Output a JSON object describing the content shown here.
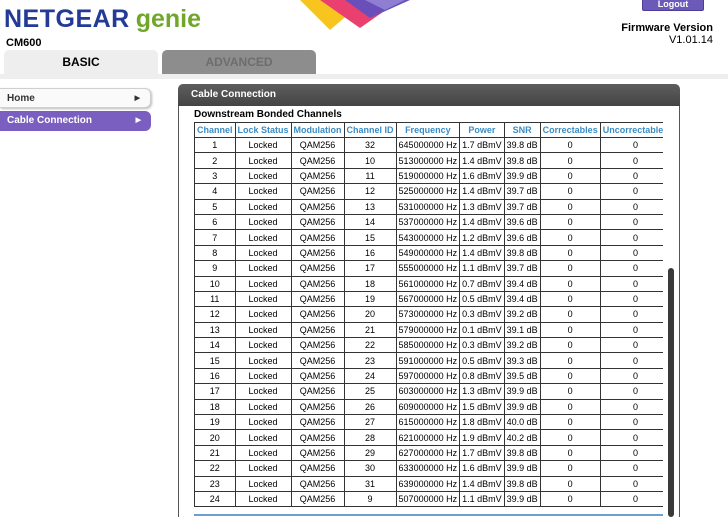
{
  "header": {
    "brand_primary": "NETGEAR",
    "brand_secondary": "genie",
    "model": "CM600",
    "logout_label": "Logout",
    "firmware_title": "Firmware Version",
    "firmware_version": "V1.01.14"
  },
  "colors": {
    "brand_blue": "#233a96",
    "brand_green": "#70a72b",
    "accent_purple": "#7a5fc0",
    "column_header_blue": "#3a8cc4"
  },
  "tabs": [
    {
      "label": "BASIC",
      "active": true
    },
    {
      "label": "ADVANCED",
      "active": false
    }
  ],
  "sidebar": {
    "items": [
      {
        "label": "Home",
        "active": false,
        "icon": "chevron-right-icon"
      },
      {
        "label": "Cable Connection",
        "active": true,
        "icon": "chevron-right-icon"
      }
    ]
  },
  "panel": {
    "title": "Cable Connection",
    "section_title": "Downstream Bonded Channels",
    "columns": [
      "Channel",
      "Lock Status",
      "Modulation",
      "Channel ID",
      "Frequency",
      "Power",
      "SNR",
      "Correctables",
      "Uncorrectables"
    ],
    "rows": [
      [
        "1",
        "Locked",
        "QAM256",
        "32",
        "645000000 Hz",
        "1.7 dBmV",
        "39.8 dB",
        "0",
        "0"
      ],
      [
        "2",
        "Locked",
        "QAM256",
        "10",
        "513000000 Hz",
        "1.4 dBmV",
        "39.8 dB",
        "0",
        "0"
      ],
      [
        "3",
        "Locked",
        "QAM256",
        "11",
        "519000000 Hz",
        "1.6 dBmV",
        "39.9 dB",
        "0",
        "0"
      ],
      [
        "4",
        "Locked",
        "QAM256",
        "12",
        "525000000 Hz",
        "1.4 dBmV",
        "39.7 dB",
        "0",
        "0"
      ],
      [
        "5",
        "Locked",
        "QAM256",
        "13",
        "531000000 Hz",
        "1.3 dBmV",
        "39.7 dB",
        "0",
        "0"
      ],
      [
        "6",
        "Locked",
        "QAM256",
        "14",
        "537000000 Hz",
        "1.4 dBmV",
        "39.6 dB",
        "0",
        "0"
      ],
      [
        "7",
        "Locked",
        "QAM256",
        "15",
        "543000000 Hz",
        "1.2 dBmV",
        "39.6 dB",
        "0",
        "0"
      ],
      [
        "8",
        "Locked",
        "QAM256",
        "16",
        "549000000 Hz",
        "1.4 dBmV",
        "39.8 dB",
        "0",
        "0"
      ],
      [
        "9",
        "Locked",
        "QAM256",
        "17",
        "555000000 Hz",
        "1.1 dBmV",
        "39.7 dB",
        "0",
        "0"
      ],
      [
        "10",
        "Locked",
        "QAM256",
        "18",
        "561000000 Hz",
        "0.7 dBmV",
        "39.4 dB",
        "0",
        "0"
      ],
      [
        "11",
        "Locked",
        "QAM256",
        "19",
        "567000000 Hz",
        "0.5 dBmV",
        "39.4 dB",
        "0",
        "0"
      ],
      [
        "12",
        "Locked",
        "QAM256",
        "20",
        "573000000 Hz",
        "0.3 dBmV",
        "39.2 dB",
        "0",
        "0"
      ],
      [
        "13",
        "Locked",
        "QAM256",
        "21",
        "579000000 Hz",
        "0.1 dBmV",
        "39.1 dB",
        "0",
        "0"
      ],
      [
        "14",
        "Locked",
        "QAM256",
        "22",
        "585000000 Hz",
        "0.3 dBmV",
        "39.2 dB",
        "0",
        "0"
      ],
      [
        "15",
        "Locked",
        "QAM256",
        "23",
        "591000000 Hz",
        "0.5 dBmV",
        "39.3 dB",
        "0",
        "0"
      ],
      [
        "16",
        "Locked",
        "QAM256",
        "24",
        "597000000 Hz",
        "0.8 dBmV",
        "39.5 dB",
        "0",
        "0"
      ],
      [
        "17",
        "Locked",
        "QAM256",
        "25",
        "603000000 Hz",
        "1.3 dBmV",
        "39.9 dB",
        "0",
        "0"
      ],
      [
        "18",
        "Locked",
        "QAM256",
        "26",
        "609000000 Hz",
        "1.5 dBmV",
        "39.9 dB",
        "0",
        "0"
      ],
      [
        "19",
        "Locked",
        "QAM256",
        "27",
        "615000000 Hz",
        "1.8 dBmV",
        "40.0 dB",
        "0",
        "0"
      ],
      [
        "20",
        "Locked",
        "QAM256",
        "28",
        "621000000 Hz",
        "1.9 dBmV",
        "40.2 dB",
        "0",
        "0"
      ],
      [
        "21",
        "Locked",
        "QAM256",
        "29",
        "627000000 Hz",
        "1.7 dBmV",
        "39.8 dB",
        "0",
        "0"
      ],
      [
        "22",
        "Locked",
        "QAM256",
        "30",
        "633000000 Hz",
        "1.6 dBmV",
        "39.9 dB",
        "0",
        "0"
      ],
      [
        "23",
        "Locked",
        "QAM256",
        "31",
        "639000000 Hz",
        "1.4 dBmV",
        "39.8 dB",
        "0",
        "0"
      ],
      [
        "24",
        "Locked",
        "QAM256",
        "9",
        "507000000 Hz",
        "1.1 dBmV",
        "39.9 dB",
        "0",
        "0"
      ]
    ]
  }
}
